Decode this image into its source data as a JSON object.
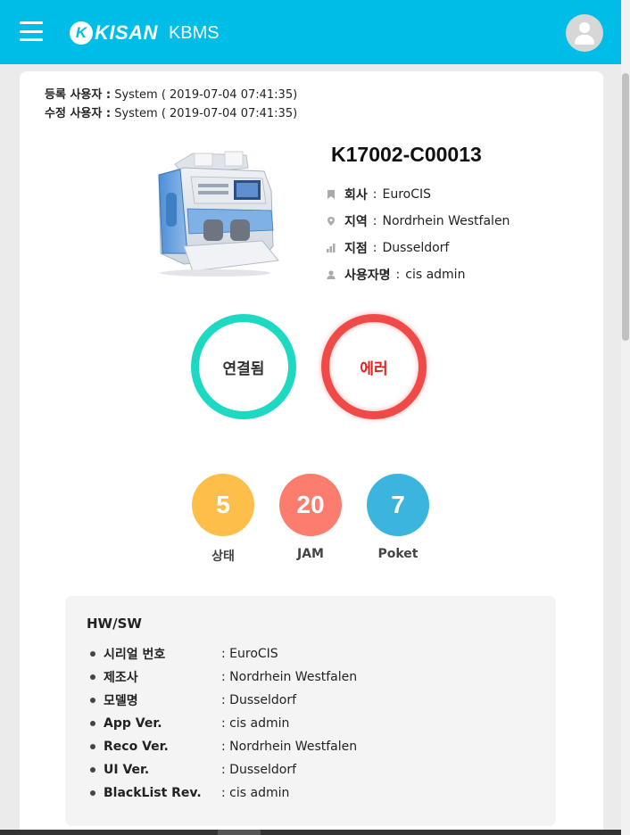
{
  "header": {
    "brand": "KISAN",
    "brand_mark": "K",
    "product": "KBMS",
    "bg_color": "#00bde8"
  },
  "meta": {
    "created_label": "등록 사용자 :",
    "created_value": "System ( 2019-07-04 07:41:35)",
    "modified_label": "수정 사용자 :",
    "modified_value": "System ( 2019-07-04 07:41:35)"
  },
  "device": {
    "id": "K17002-C00013",
    "fields": [
      {
        "icon": "bookmark-icon",
        "label": "회사",
        "sep": ":",
        "value": "EuroCIS"
      },
      {
        "icon": "location-pin-icon",
        "label": "지역",
        "sep": ":",
        "value": "Nordrhein Westfalen"
      },
      {
        "icon": "bar-chart-icon",
        "label": "지점",
        "sep": ":",
        "value": "Dusseldorf"
      },
      {
        "icon": "user-icon",
        "label": "사용자명",
        "sep": ":",
        "value": "cis admin"
      }
    ]
  },
  "status": {
    "connected_label": "연결됨",
    "error_label": "에러",
    "connected_color": "#1dd9c2",
    "error_color": "#ef4a48"
  },
  "stats": [
    {
      "value": "5",
      "label": "상태",
      "color": "#fdbf4a"
    },
    {
      "value": "20",
      "label": "JAM",
      "color": "#fc7c6e"
    },
    {
      "value": "7",
      "label": "Poket",
      "color": "#3bb5dd"
    }
  ],
  "hwsw": {
    "title": "HW/SW",
    "rows": [
      {
        "label": "시리얼 번호",
        "value": ": EuroCIS"
      },
      {
        "label": "제조사",
        "value": ": Nordrhein Westfalen"
      },
      {
        "label": "모델명",
        "value": ": Dusseldorf"
      },
      {
        "label": "App Ver.",
        "value": ": cis admin"
      },
      {
        "label": "Reco Ver.",
        "value": ": Nordrhein Westfalen"
      },
      {
        "label": "UI Ver.",
        "value": ": Dusseldorf"
      },
      {
        "label": "BlackList Rev.",
        "value": ": cis admin"
      }
    ]
  }
}
